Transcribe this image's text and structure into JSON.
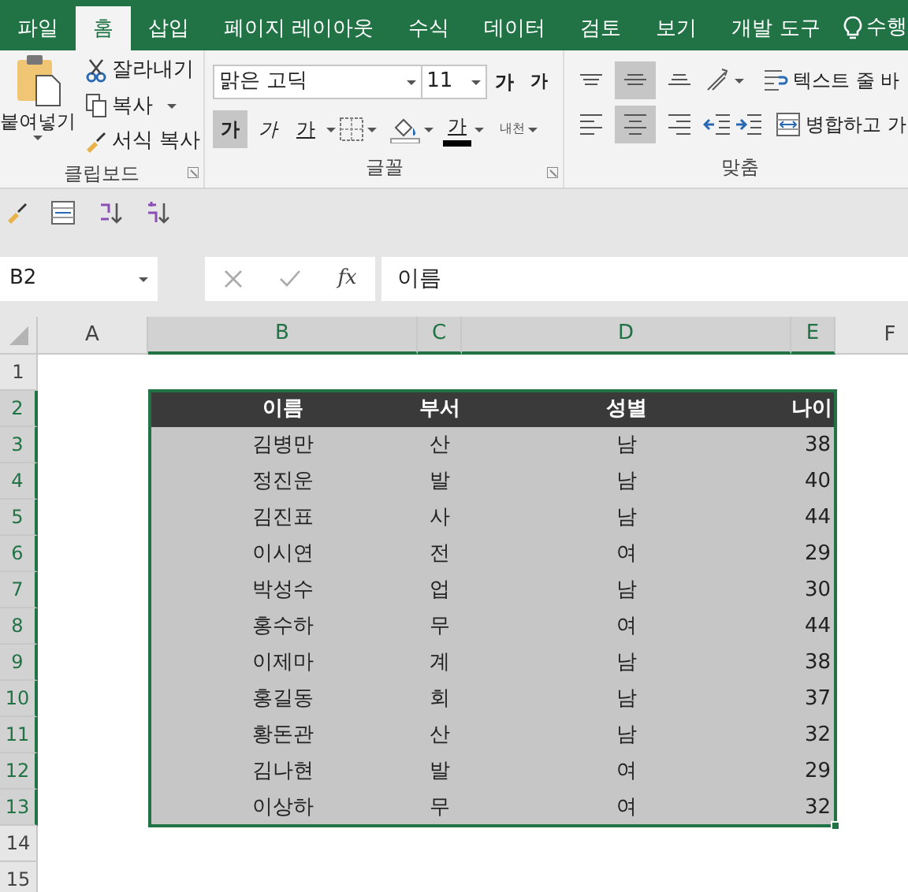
{
  "tabs": [
    {
      "label": "파일",
      "selected": false
    },
    {
      "label": "홈",
      "selected": true
    },
    {
      "label": "삽입",
      "selected": false
    },
    {
      "label": "페이지 레이아웃",
      "selected": false
    },
    {
      "label": "수식",
      "selected": false
    },
    {
      "label": "데이터",
      "selected": false
    },
    {
      "label": "검토",
      "selected": false
    },
    {
      "label": "보기",
      "selected": false
    },
    {
      "label": "개발 도구",
      "selected": false
    }
  ],
  "tell_me": "수행",
  "clipboard": {
    "label": "클립보드",
    "paste": "붙여넣기",
    "cut": "잘라내기",
    "copy": "복사",
    "format_painter": "서식 복사"
  },
  "font": {
    "label": "글꼴",
    "font_name": "맑은 고딕",
    "font_size": "11",
    "grow": "가",
    "shrink": "가",
    "font_color_label": "가",
    "phonetic": "내천",
    "style_buttons": [
      {
        "kind": "bold",
        "label": "가",
        "selected": true
      },
      {
        "kind": "italic",
        "label": "가",
        "selected": false
      },
      {
        "kind": "underline",
        "label": "가",
        "selected": false
      }
    ]
  },
  "alignment": {
    "label": "맞춤",
    "wrap_text": "텍스트 줄 바",
    "merge_center": "병합하고 가",
    "vertical": [
      {
        "kind": "top",
        "selected": false
      },
      {
        "kind": "middle",
        "selected": true
      },
      {
        "kind": "bottom",
        "selected": false
      }
    ],
    "horizontal": [
      {
        "kind": "left",
        "selected": false
      },
      {
        "kind": "center",
        "selected": true
      },
      {
        "kind": "right",
        "selected": false
      }
    ]
  },
  "name_box": "B2",
  "function_label": "fx",
  "formula": "이름",
  "columns": [
    {
      "label": "A",
      "selected": false
    },
    {
      "label": "B",
      "selected": true
    },
    {
      "label": "C",
      "selected": true
    },
    {
      "label": "D",
      "selected": true
    },
    {
      "label": "E",
      "selected": true
    },
    {
      "label": "F",
      "selected": false
    }
  ],
  "rows": [
    {
      "label": "1",
      "selected": false
    },
    {
      "label": "2",
      "selected": true
    },
    {
      "label": "3",
      "selected": true
    },
    {
      "label": "4",
      "selected": true
    },
    {
      "label": "5",
      "selected": true
    },
    {
      "label": "6",
      "selected": true
    },
    {
      "label": "7",
      "selected": true
    },
    {
      "label": "8",
      "selected": true
    },
    {
      "label": "9",
      "selected": true
    },
    {
      "label": "10",
      "selected": true
    },
    {
      "label": "11",
      "selected": true
    },
    {
      "label": "12",
      "selected": true
    },
    {
      "label": "13",
      "selected": true
    },
    {
      "label": "14",
      "selected": false
    },
    {
      "label": "15",
      "selected": false
    }
  ],
  "table": {
    "header": [
      "이름",
      "부서",
      "성별",
      "나이"
    ],
    "rows": [
      [
        "김병만",
        "산",
        "남",
        "38"
      ],
      [
        "정진운",
        "발",
        "남",
        "40"
      ],
      [
        "김진표",
        "사",
        "남",
        "44"
      ],
      [
        "이시연",
        "전",
        "여",
        "29"
      ],
      [
        "박성수",
        "업",
        "남",
        "30"
      ],
      [
        "홍수하",
        "무",
        "여",
        "44"
      ],
      [
        "이제마",
        "계",
        "남",
        "38"
      ],
      [
        "홍길동",
        "회",
        "남",
        "37"
      ],
      [
        "황돈관",
        "산",
        "남",
        "32"
      ],
      [
        "김나현",
        "발",
        "여",
        "29"
      ],
      [
        "이상하",
        "무",
        "여",
        "32"
      ]
    ]
  }
}
